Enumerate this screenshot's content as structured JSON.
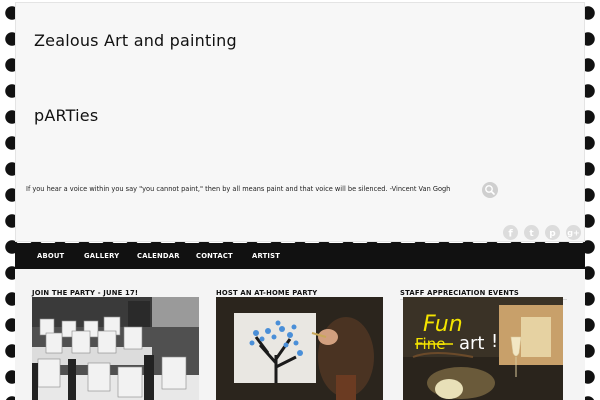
{
  "header": {
    "title_line1": "Zealous Art and painting",
    "title_line2": "pARTies",
    "tagline": "If you hear a voice within you say \"you cannot paint,\" then by all means paint and that voice will be silenced. -Vincent Van Gogh"
  },
  "social_icons": [
    "facebook-icon",
    "twitter-icon",
    "pinterest-icon",
    "google-plus-icon"
  ],
  "nav": {
    "items": [
      "ABOUT",
      "GALLERY",
      "CALENDAR",
      "CONTACT",
      "ARTIST"
    ]
  },
  "widgets": [
    {
      "title": "JOIN THE PARTY - JUNE 17!"
    },
    {
      "title": "HOST AN AT-HOME PARTY"
    },
    {
      "title": "STAFF APPRECIATION EVENTS",
      "image_text_1": "Fun",
      "image_text_2": "Fine",
      "image_text_3": "art",
      "image_text_4": "!"
    }
  ],
  "colors": {
    "nav_background": "#111111",
    "header_background": "#f7f7f7",
    "accent_yellow": "#f4e400"
  }
}
